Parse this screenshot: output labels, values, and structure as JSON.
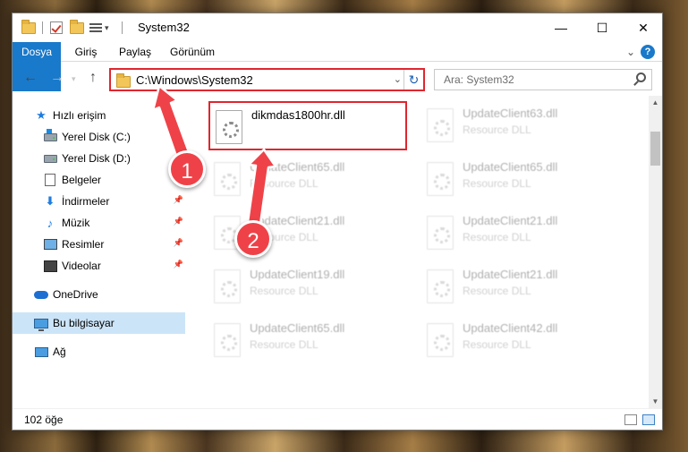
{
  "window": {
    "title": "System32",
    "controls": {
      "minimize": "—",
      "maximize": "☐",
      "close": "✕"
    }
  },
  "ribbon": {
    "tabs": [
      "Dosya",
      "Giriş",
      "Paylaş",
      "Görünüm"
    ],
    "help": "?",
    "collapse": "⌄"
  },
  "nav": {
    "back": "←",
    "forward": "→",
    "up": "↑",
    "address": "C:\\Windows\\System32",
    "refresh": "↻",
    "search_placeholder": "Ara: System32"
  },
  "sidebar": {
    "items": [
      {
        "label": "Hızlı erişim",
        "icon": "star-icon",
        "pinned": false
      },
      {
        "label": "Yerel Disk (C:)",
        "icon": "windows-drive-icon",
        "pinned": true
      },
      {
        "label": "Yerel Disk (D:)",
        "icon": "drive-icon",
        "pinned": true
      },
      {
        "label": "Belgeler",
        "icon": "document-icon",
        "pinned": true
      },
      {
        "label": "İndirmeler",
        "icon": "download-icon",
        "pinned": true
      },
      {
        "label": "Müzik",
        "icon": "music-icon",
        "pinned": true
      },
      {
        "label": "Resimler",
        "icon": "pictures-icon",
        "pinned": true
      },
      {
        "label": "Videolar",
        "icon": "video-icon",
        "pinned": true
      },
      {
        "label": "OneDrive",
        "icon": "cloud-icon",
        "pinned": false
      },
      {
        "label": "Bu bilgisayar",
        "icon": "computer-icon",
        "pinned": false
      },
      {
        "label": "Ağ",
        "icon": "network-icon",
        "pinned": false
      }
    ]
  },
  "files": [
    {
      "name": "dikmdas1800hr.dll",
      "type": "",
      "highlighted": true
    },
    {
      "name": "UpdateClient63.dll",
      "type": "Resource DLL"
    },
    {
      "name": "UpdateClient65.dll",
      "type": "Resource DLL"
    },
    {
      "name": "UpdateClient65.dll",
      "type": "Resource DLL"
    },
    {
      "name": "UpdateClient21.dll",
      "type": "Resource DLL"
    },
    {
      "name": "UpdateClient21.dll",
      "type": "Resource DLL"
    },
    {
      "name": "UpdateClient19.dll",
      "type": "Resource DLL"
    },
    {
      "name": "UpdateClient21.dll",
      "type": "Resource DLL"
    },
    {
      "name": "UpdateClient65.dll",
      "type": "Resource DLL"
    },
    {
      "name": "UpdateClient42.dll",
      "type": "Resource DLL"
    }
  ],
  "status": {
    "count": "102 öğe"
  },
  "annotations": {
    "step1": "1",
    "step2": "2",
    "color": "#ef4248"
  },
  "colors": {
    "accent": "#1979ca",
    "highlight": "#e0262e",
    "selected": "#cce4f7"
  }
}
